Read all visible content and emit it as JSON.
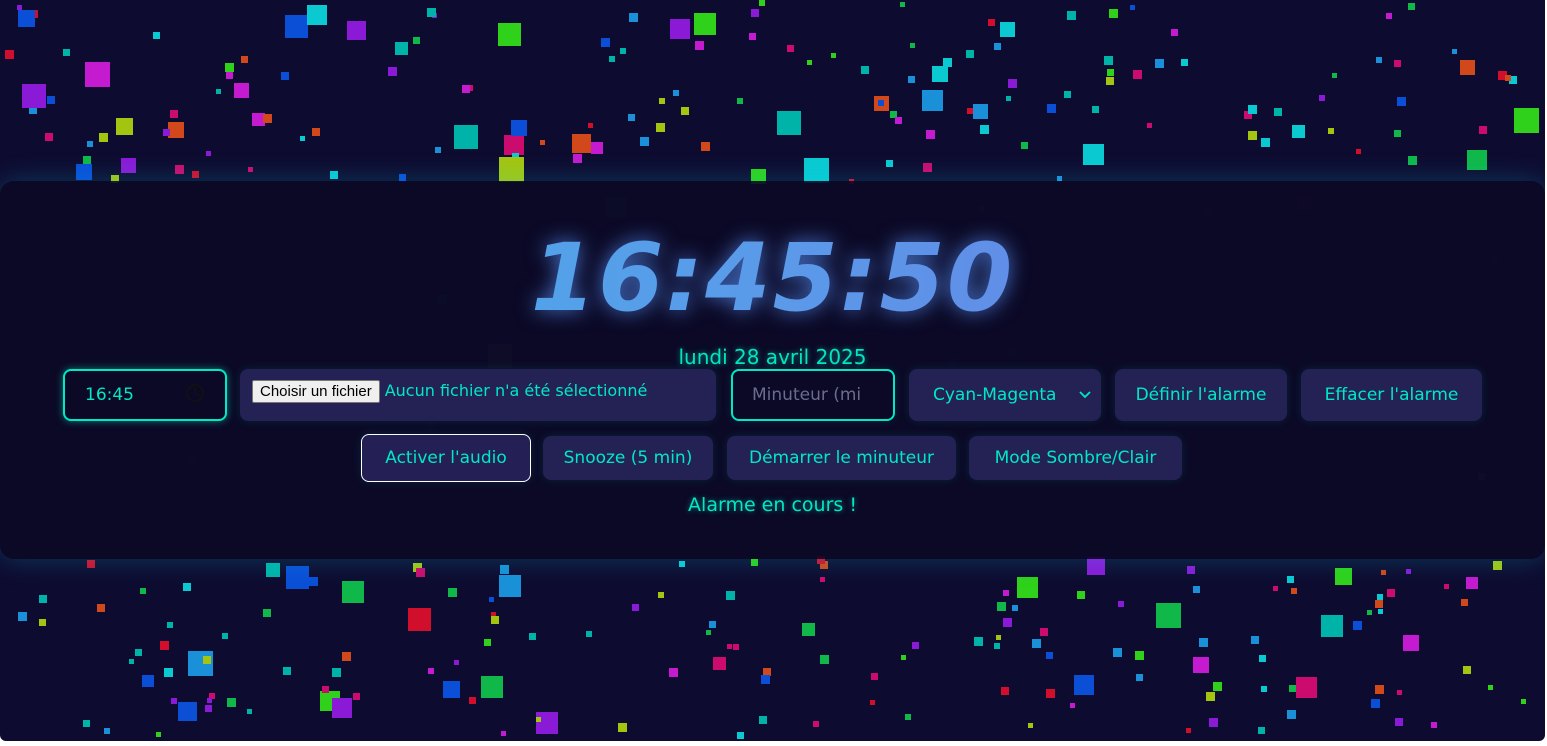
{
  "clock": {
    "time": "16:45:50",
    "date": "lundi 28 avril 2025"
  },
  "controls": {
    "alarm_time_value": "16:45",
    "file_button_label": "Choisir un fichier",
    "file_status": "Aucun fichier n'a été sélectionné",
    "timer_placeholder": "Minuteur (mi",
    "theme_selected": "Cyan-Magenta",
    "set_alarm_label": "Définir l'alarme",
    "clear_alarm_label": "Effacer l'alarme",
    "audio_label": "Activer l'audio",
    "snooze_label": "Snooze (5 min)",
    "start_timer_label": "Démarrer le minuteur",
    "mode_label": "Mode Sombre/Clair"
  },
  "status": {
    "alarm_message": "Alarme en cours !"
  },
  "colors": {
    "background": "#0e0b30",
    "accent": "#00e8c4",
    "clock_gradient_start": "#3fb3e8",
    "clock_gradient_end": "#6c74e6"
  },
  "icons": {
    "time_input": "clock-icon",
    "select": "chevron-down-icon"
  }
}
